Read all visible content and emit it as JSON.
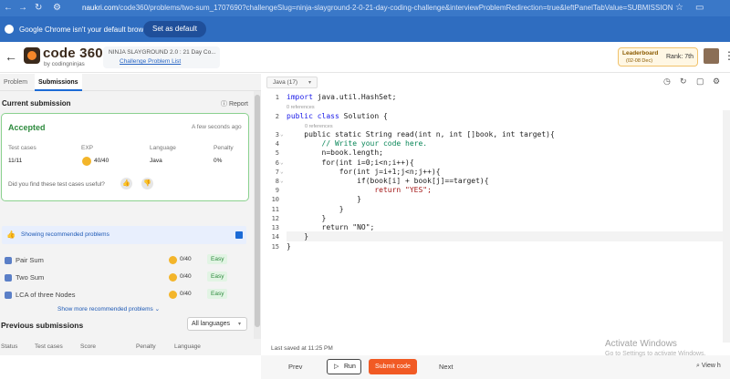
{
  "browser": {
    "url_domain": "naukri.com",
    "url_path": "/code360/problems/two-sum_1707690?challengeSlug=ninja-slayground-2-0-21-day-coding-challenge&interviewProblemRedirection=true&leftPanelTabValue=SUBMISSION",
    "infobar_message": "Google Chrome isn't your default browser",
    "set_default_label": "Set as default"
  },
  "header": {
    "logo_text": "code 360",
    "logo_sub": "by codingninjas",
    "challenge_title": "NINJA SLAYGROUND 2.0 : 21 Day Co...",
    "challenge_link": "Challenge Problem List",
    "leaderboard_label": "Leaderboard",
    "leaderboard_dates": "(02-08 Dec)",
    "rank_label": "Rank: 7th"
  },
  "left": {
    "tabs": [
      {
        "label": "Problem"
      },
      {
        "label": "Submissions"
      }
    ],
    "current_title": "Current submission",
    "report_label": "Report",
    "submission": {
      "status": "Accepted",
      "time": "A few seconds ago",
      "headers": [
        "Test cases",
        "EXP",
        "Language",
        "Penalty"
      ],
      "test_cases": "11/11",
      "exp": "40/40",
      "language": "Java",
      "penalty": "0%",
      "question": "Did you find these test cases useful?"
    },
    "rec_banner": "Showing recommended problems",
    "recommended": [
      {
        "name": "Pair Sum",
        "exp": "0/40",
        "difficulty": "Easy"
      },
      {
        "name": "Two Sum",
        "exp": "0/40",
        "difficulty": "Easy"
      },
      {
        "name": "LCA of three Nodes",
        "exp": "0/40",
        "difficulty": "Easy"
      }
    ],
    "show_more": "Show more recommended problems",
    "prev_title": "Previous submissions",
    "lang_filter": "All languages",
    "prev_headers": [
      "Status",
      "Test cases",
      "Score",
      "Penalty",
      "Language"
    ]
  },
  "editor": {
    "language": "Java (17)",
    "ref_label": "0 references",
    "lines": [
      "import java.util.HashSet;",
      "public class Solution {",
      "    public static String read(int n, int []book, int target){",
      "        // Write your code here.",
      "        n=book.length;",
      "        for(int i=0;i<n;i++){",
      "            for(int j=i+1;j<n;j++){",
      "                if(book[i] + book[j]==target){",
      "                    return \"YES\";",
      "                }",
      "            }",
      "        }",
      "        return \"NO\";",
      "    }",
      "}"
    ],
    "last_saved": "Last saved at 11:25 PM"
  },
  "actions": {
    "prev": "Prev",
    "run": "Run",
    "submit": "Submit code",
    "next": "Next"
  },
  "watermark": {
    "line1": "Activate Windows",
    "line2": "Go to Settings to activate Windows.",
    "view": "View h"
  },
  "colors": {
    "accent": "#1c6bd6",
    "accepted": "#2e8b3e",
    "submit": "#f15a24",
    "brand": "#f5872a"
  }
}
